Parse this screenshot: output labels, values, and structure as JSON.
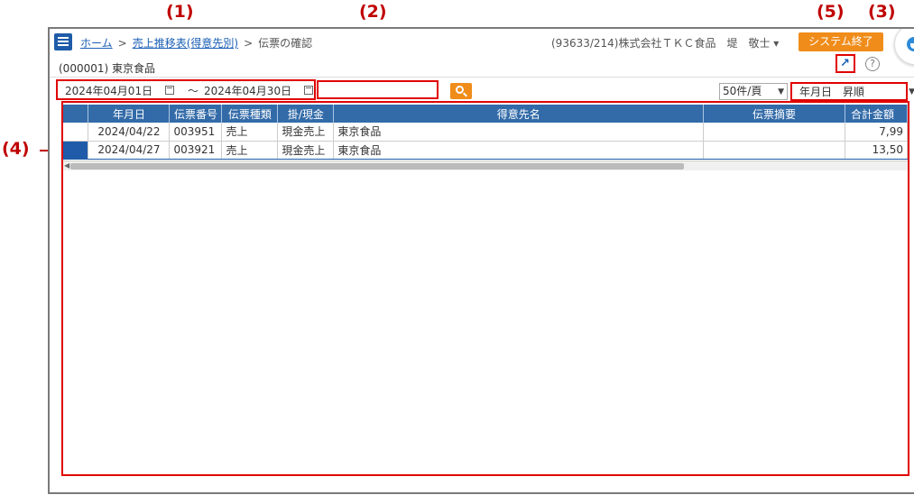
{
  "callouts": {
    "c1": "(1)",
    "c2": "(2)",
    "c3": "(3)",
    "c4": "(4)",
    "c5": "(5)"
  },
  "breadcrumb": {
    "home": "ホーム",
    "report": "売上推移表(得意先別)",
    "current": "伝票の確認",
    "separator": ">"
  },
  "header": {
    "company_info": "(93633/214)株式会社ＴＫＣ食品　堤　敬士 ▾",
    "exit_label": "システム終了",
    "customer": "(000001) 東京食品",
    "help": "?"
  },
  "filters": {
    "date_from": "2024年04月01日",
    "date_to": "2024年04月30日",
    "tilde": "～",
    "search_value": "",
    "per_page": "50件/頁",
    "sort": "年月日　昇順"
  },
  "table": {
    "columns": [
      "年月日",
      "伝票番号",
      "伝票種類",
      "掛/現金",
      "得意先名",
      "伝票摘要",
      "合計金額"
    ],
    "rows": [
      {
        "date": "2024/04/22",
        "slip_no": "003951",
        "slip_type": "売上",
        "payment": "現金売上",
        "customer": "東京食品",
        "memo": "",
        "total": "7,99"
      },
      {
        "date": "2024/04/27",
        "slip_no": "003921",
        "slip_type": "売上",
        "payment": "現金売上",
        "customer": "東京食品",
        "memo": "",
        "total": "13,50"
      }
    ]
  },
  "colors": {
    "accent_blue": "#1f5ba8",
    "header_blue": "#336ba8",
    "orange": "#f08c1a",
    "callout_red": "#c00000"
  }
}
